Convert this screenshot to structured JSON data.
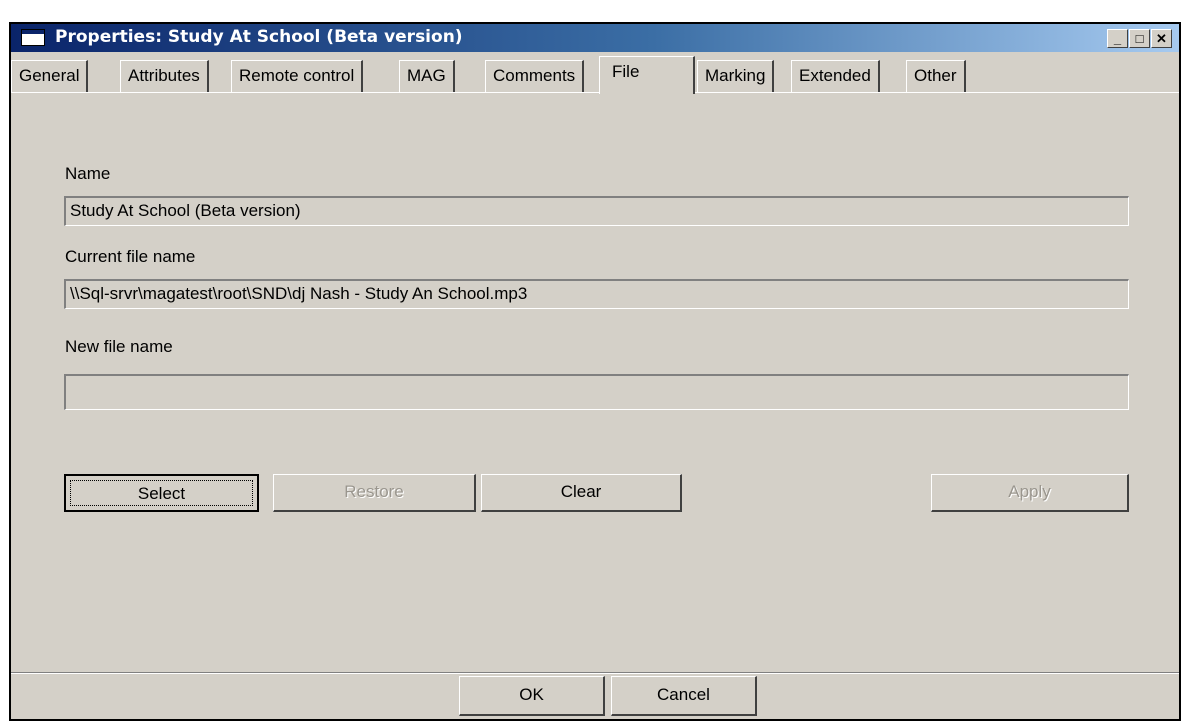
{
  "window": {
    "title": "Properties: Study At School (Beta version)",
    "controls": {
      "minimize": "_",
      "maximize": "□",
      "close": "✕"
    }
  },
  "tabs": [
    {
      "label": "General"
    },
    {
      "label": "Attributes"
    },
    {
      "label": "Remote control"
    },
    {
      "label": "MAG"
    },
    {
      "label": "Comments"
    },
    {
      "label": "File",
      "active": true
    },
    {
      "label": "Marking"
    },
    {
      "label": "Extended"
    },
    {
      "label": "Other"
    }
  ],
  "file_tab": {
    "name_label": "Name",
    "name_value": "Study At School (Beta version)",
    "current_file_label": "Current file name",
    "current_file_value": "\\\\Sql-srvr\\magatest\\root\\SND\\dj Nash - Study An School.mp3",
    "new_file_label": "New file name",
    "new_file_value": ""
  },
  "buttons": {
    "select": "Select",
    "restore": "Restore",
    "clear": "Clear",
    "apply": "Apply",
    "ok": "OK",
    "cancel": "Cancel"
  }
}
